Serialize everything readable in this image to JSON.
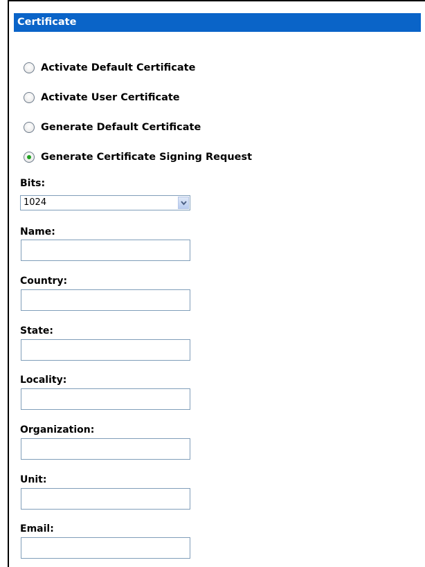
{
  "header": {
    "title": "Certificate"
  },
  "options": [
    {
      "label": "Activate Default Certificate",
      "checked": false
    },
    {
      "label": "Activate User Certificate",
      "checked": false
    },
    {
      "label": "Generate Default Certificate",
      "checked": false
    },
    {
      "label": "Generate Certificate Signing Request",
      "checked": true
    }
  ],
  "bits": {
    "label": "Bits:",
    "value": "1024"
  },
  "fields": {
    "name": {
      "label": "Name:",
      "value": ""
    },
    "country": {
      "label": "Country:",
      "value": ""
    },
    "state": {
      "label": "State:",
      "value": ""
    },
    "locality": {
      "label": "Locality:",
      "value": ""
    },
    "organization": {
      "label": "Organization:",
      "value": ""
    },
    "unit": {
      "label": "Unit:",
      "value": ""
    },
    "email": {
      "label": "Email:",
      "value": ""
    }
  },
  "colors": {
    "header_bg": "#0a64c8",
    "radio_checked": "#21a121",
    "input_border": "#7f9db9"
  }
}
